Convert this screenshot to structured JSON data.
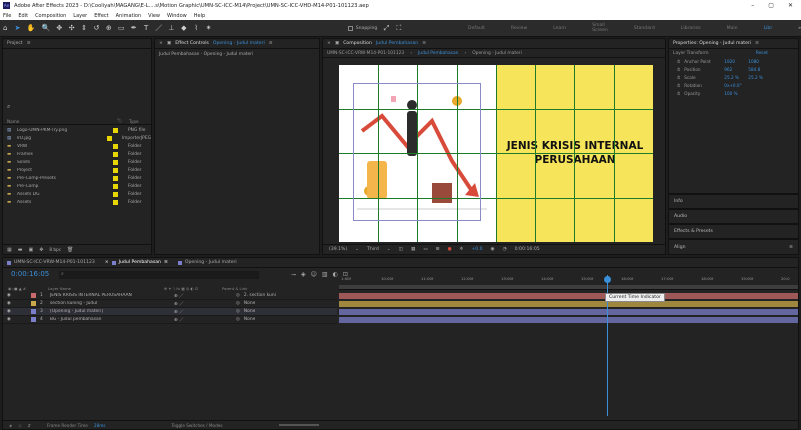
{
  "window": {
    "title": "Adobe After Effects 2023 - D:\\Cooliyah\\MAGANG\\E-L....s\\Motion Graphic\\UMN-SC-ICC-M14\\Project\\UMN-SC-ICC-VHD-M14-P01-101123.aep",
    "controls": [
      "–",
      "▢",
      "✕"
    ]
  },
  "menu": [
    "File",
    "Edit",
    "Composition",
    "Layer",
    "Effect",
    "Animation",
    "View",
    "Window",
    "Help"
  ],
  "toolbar": {
    "snapping_label": "Snapping",
    "workspaces": [
      "Default",
      "Review",
      "Learn",
      "Small Screen",
      "Standard",
      "Libraries",
      "Main"
    ],
    "active_workspace": "Libr",
    "more": "»"
  },
  "project_panel": {
    "tab": "Project",
    "columns": {
      "name": "Name",
      "type": "Type"
    },
    "items": [
      {
        "name": "Logo-UMN-PKM-Try.png",
        "type": "PNG file"
      },
      {
        "name": "VO.jpg",
        "type": "ImporterJPEG"
      },
      {
        "name": "VRW",
        "type": "Folder"
      },
      {
        "name": "Frames",
        "type": "Folder"
      },
      {
        "name": "Solids",
        "type": "Folder"
      },
      {
        "name": "Project",
        "type": "Folder"
      },
      {
        "name": "Pre-Comp-Presets",
        "type": "Folder"
      },
      {
        "name": "Pre-Comp",
        "type": "Folder"
      },
      {
        "name": "Assets DG",
        "type": "Folder"
      },
      {
        "name": "Assets",
        "type": "Folder"
      }
    ],
    "footer_bpc": "8 bpc"
  },
  "effect_controls": {
    "tab": "Effect Controls",
    "layer": "Opening - Judul materi",
    "breadcrumb": "Judul Pembahasan · Opening - Judul materi"
  },
  "composition_panel": {
    "tab": "Composition",
    "comp_name": "Judul Pembahasan",
    "breadcrumbs": [
      "UMN-SC-ICC-VRW-M14-P01-101123",
      "Judul Pembahasan",
      "Opening - Judul materi"
    ],
    "slide_title": "JENIS KRISIS INTERNAL PERUSAHAAN",
    "zoom": "(39.1%)",
    "resolution": "Third",
    "exposure": "+0.0",
    "timecode": "0:00:16:05",
    "accent_yellow": "#f6e45a"
  },
  "properties_panel": {
    "title": "Properties: Opening - Judul materi",
    "section": "Layer Transform",
    "reset": "Reset",
    "props": [
      {
        "label": "Anchor Point",
        "v1": "1920",
        "v2": "1080"
      },
      {
        "label": "Position",
        "v1": "962",
        "v2": "584.8"
      },
      {
        "label": "Scale",
        "v1": "25.2 %",
        "v2": "25.2 %"
      },
      {
        "label": "Rotation",
        "v1": "0x+0.0°",
        "v2": ""
      },
      {
        "label": "Opacity",
        "v1": "100 %",
        "v2": ""
      }
    ],
    "side_panels": [
      "Info",
      "Audio",
      "Effects & Presets",
      "Align"
    ]
  },
  "timeline": {
    "tabs": [
      "UMN-SC-ICC-VRW-M14-P01-101123",
      "Judul Pembahasan",
      "Opening - Judul materi"
    ],
    "current_time": "0:00:16:05",
    "search_placeholder": "",
    "columns": {
      "name": "Layer Name",
      "parent": "Parent & Link"
    },
    "layers": [
      {
        "num": "1",
        "name": "JENIS KRISIS INTERNAL PERUSAHAAN",
        "parent": "2. section kuni",
        "color": "#c96b6b"
      },
      {
        "num": "2",
        "name": "section kuning - Judul",
        "parent": "None",
        "color": "#c9a94a"
      },
      {
        "num": "3",
        "name": "[Opening - Judul materi]",
        "parent": "None",
        "color": "#7b7fc9"
      },
      {
        "num": "4",
        "name": "BG - Judul pembahasan",
        "parent": "None",
        "color": "#7b7fc9"
      }
    ],
    "ruler": [
      "1:00f",
      "10:00f",
      "11:00f",
      "12:00f",
      "13:00f",
      "14:00f",
      "15:00f",
      "16:00f",
      "17:00f",
      "18:00f",
      "19:00f",
      "20:0"
    ],
    "tooltip": "Current Time Indicator",
    "footer": {
      "render_label": "Frame Render Time",
      "render_value": "28ms",
      "toggle": "Toggle Switches / Modes"
    },
    "playhead_fraction": 0.584
  }
}
